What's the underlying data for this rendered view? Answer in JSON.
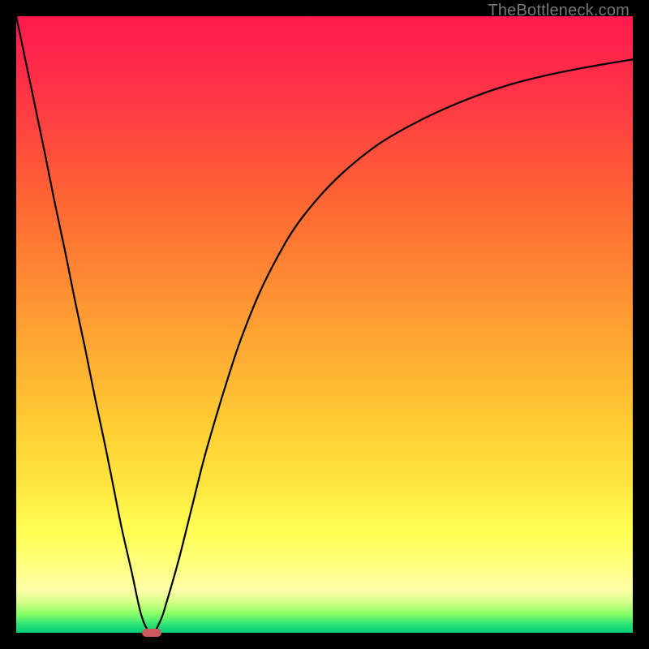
{
  "watermark": "TheBottleneck.com",
  "chart_data": {
    "type": "line",
    "title": "",
    "xlabel": "",
    "ylabel": "",
    "xlim": [
      0,
      100
    ],
    "ylim": [
      0,
      100
    ],
    "grid": false,
    "legend": false,
    "series": [
      {
        "name": "bottleneck-curve",
        "x": [
          0.0,
          2.1,
          4.6,
          6.2,
          7.9,
          9.5,
          11.2,
          12.8,
          14.5,
          15.8,
          17.1,
          18.7,
          20.4,
          22.0,
          23.4,
          24.4,
          26.4,
          28.4,
          30.4,
          32.4,
          34.4,
          36.4,
          39.4,
          42.4,
          45.4,
          49.4,
          53.4,
          58.4,
          63.4,
          68.4,
          74.4,
          80.4,
          86.4,
          92.4,
          100.0
        ],
        "y": [
          100.0,
          90.0,
          78.0,
          70.0,
          62.0,
          54.0,
          46.0,
          38.0,
          30.0,
          23.5,
          17.0,
          10.0,
          2.5,
          0.0,
          2.0,
          5.0,
          12.0,
          20.0,
          28.0,
          35.0,
          41.5,
          47.5,
          55.0,
          61.0,
          66.0,
          71.0,
          75.0,
          79.0,
          82.0,
          84.5,
          87.0,
          89.0,
          90.5,
          91.7,
          93.0
        ]
      }
    ],
    "marker": {
      "x": 22.0,
      "y": 0.0,
      "width_pct": 3.2,
      "height_pct": 1.4,
      "color": "#cc5a5a"
    },
    "background_gradient": {
      "top": "#ff1a4d",
      "mid_upper": "#ff8833",
      "mid_lower": "#ffff55",
      "bottom": "#00cc77"
    }
  }
}
